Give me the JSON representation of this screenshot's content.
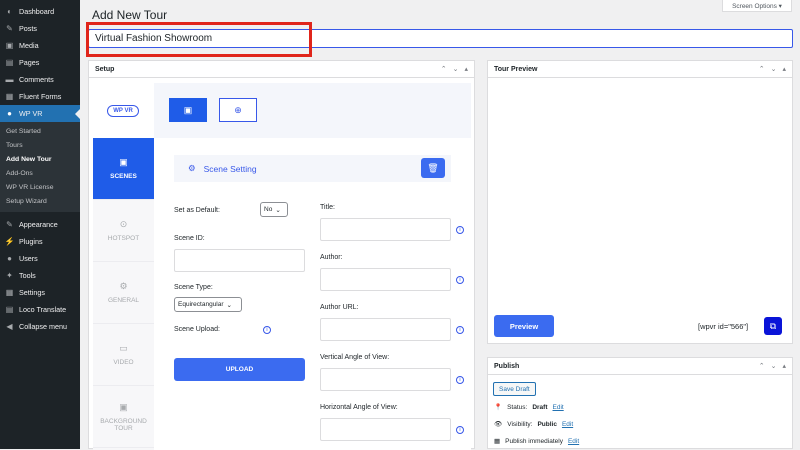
{
  "menu": {
    "items_top": [
      {
        "icon": "dashboard-icon",
        "glyph": "◐",
        "label": "Dashboard"
      },
      {
        "icon": "pin-icon",
        "glyph": "✎",
        "label": "Posts"
      },
      {
        "icon": "media-icon",
        "glyph": "▣",
        "label": "Media"
      },
      {
        "icon": "page-icon",
        "glyph": "▤",
        "label": "Pages"
      },
      {
        "icon": "comment-icon",
        "glyph": "▬",
        "label": "Comments"
      },
      {
        "icon": "forms-icon",
        "glyph": "▦",
        "label": "Fluent Forms"
      },
      {
        "icon": "wpvr-icon",
        "glyph": "●",
        "label": "WP VR"
      }
    ],
    "submenu": [
      "Get Started",
      "Tours",
      "Add New Tour",
      "Add-Ons",
      "WP VR License",
      "Setup Wizard"
    ],
    "items_bottom": [
      {
        "icon": "brush-icon",
        "glyph": "✎",
        "label": "Appearance"
      },
      {
        "icon": "plugin-icon",
        "glyph": "⚡",
        "label": "Plugins"
      },
      {
        "icon": "user-icon",
        "glyph": "●",
        "label": "Users"
      },
      {
        "icon": "wrench-icon",
        "glyph": "✦",
        "label": "Tools"
      },
      {
        "icon": "settings-icon",
        "glyph": "▦",
        "label": "Settings"
      },
      {
        "icon": "translate-icon",
        "glyph": "▤",
        "label": "Loco Translate"
      },
      {
        "icon": "collapse-icon",
        "glyph": "◀",
        "label": "Collapse menu"
      }
    ]
  },
  "screen_options": "Screen Options ▾",
  "page_title": "Add New Tour",
  "title_value": "Virtual Fashion Showroom",
  "setup": {
    "header": "Setup",
    "logo_text": "WP VR",
    "tabs": [
      "SCENES",
      "HOTSPOT",
      "GENERAL",
      "VIDEO",
      "BACKGROUND TOUR"
    ],
    "scene_setting": "Scene Setting",
    "set_default_label": "Set as Default:",
    "set_default_value": "No",
    "scene_id_label": "Scene ID:",
    "scene_type_label": "Scene Type:",
    "scene_type_value": "Equirectangular",
    "scene_upload_label": "Scene Upload:",
    "upload_label": "UPLOAD",
    "title_label": "Title:",
    "author_label": "Author:",
    "author_url_label": "Author URL:",
    "vangle_label": "Vertical Angle of View:",
    "hangle_label": "Horizontal Angle of View:"
  },
  "preview": {
    "header": "Tour Preview",
    "button": "Preview",
    "shortcode": "[wpvr id=\"566\"]"
  },
  "publish": {
    "header": "Publish",
    "save_draft": "Save Draft",
    "status_label": "Status:",
    "status_value": "Draft",
    "visibility_label": "Visibility:",
    "visibility_value": "Public",
    "schedule": "Publish immediately",
    "edit": "Edit"
  },
  "colors": {
    "accent": "#3b6bf0",
    "highlight": "#e0251b",
    "menu_active": "#2271b1"
  }
}
